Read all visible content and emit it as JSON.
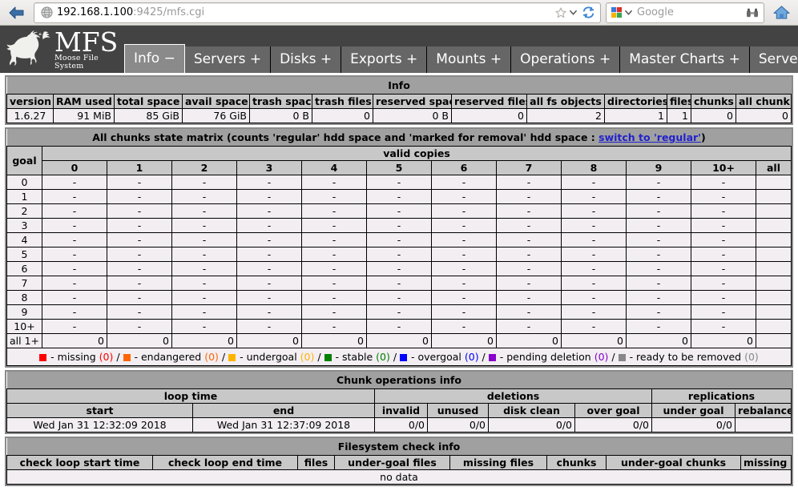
{
  "browser": {
    "back_icon": "back-arrow-icon",
    "favicon": "globe-icon",
    "url_host": "192.168.1.100",
    "url_rest": ":9425/mfs.cgi",
    "star_icon": "star-icon",
    "chevron_icon": "chevron-down-icon",
    "reload_icon": "reload-icon",
    "search_engine_icon": "google-icon",
    "search_placeholder": "Google",
    "search_value": "",
    "binoculars_icon": "binoculars-icon",
    "home_icon": "home-icon"
  },
  "header": {
    "logo_title": "MFS",
    "logo_subtitle": "Moose File System",
    "moose_icon": "moose-logo-icon",
    "tabs": [
      {
        "label": "Info −",
        "active": true
      },
      {
        "label": "Servers +",
        "active": false
      },
      {
        "label": "Disks +",
        "active": false
      },
      {
        "label": "Exports +",
        "active": false
      },
      {
        "label": "Mounts +",
        "active": false
      },
      {
        "label": "Operations +",
        "active": false
      },
      {
        "label": "Master Charts +",
        "active": false
      },
      {
        "label": "Server Charts +",
        "active": false
      }
    ]
  },
  "info": {
    "title": "Info",
    "columns": [
      "version",
      "RAM used",
      "total space",
      "avail space",
      "trash space",
      "trash files",
      "reserved space",
      "reserved files",
      "all fs objects",
      "directories",
      "files",
      "chunks",
      "all chunk copies"
    ],
    "row": [
      "1.6.27",
      "91 MiB",
      "85 GiB",
      "76 GiB",
      "0 B",
      "0",
      "0 B",
      "0",
      "2",
      "1",
      "1",
      "0",
      "0"
    ]
  },
  "matrix": {
    "title_pre": "All chunks state matrix (counts 'regular' hdd space and 'marked for removal' hdd space : ",
    "title_link": "switch to 'regular'",
    "title_post": ")",
    "goal_label": "goal",
    "valid_copies_label": "valid copies",
    "columns": [
      "0",
      "1",
      "2",
      "3",
      "4",
      "5",
      "6",
      "7",
      "8",
      "9",
      "10+",
      "all"
    ],
    "rows": [
      {
        "goal": "0",
        "values": [
          "-",
          "-",
          "-",
          "-",
          "-",
          "-",
          "-",
          "-",
          "-",
          "-",
          "-",
          ""
        ]
      },
      {
        "goal": "1",
        "values": [
          "-",
          "-",
          "-",
          "-",
          "-",
          "-",
          "-",
          "-",
          "-",
          "-",
          "-",
          ""
        ]
      },
      {
        "goal": "2",
        "values": [
          "-",
          "-",
          "-",
          "-",
          "-",
          "-",
          "-",
          "-",
          "-",
          "-",
          "-",
          ""
        ]
      },
      {
        "goal": "3",
        "values": [
          "-",
          "-",
          "-",
          "-",
          "-",
          "-",
          "-",
          "-",
          "-",
          "-",
          "-",
          ""
        ]
      },
      {
        "goal": "4",
        "values": [
          "-",
          "-",
          "-",
          "-",
          "-",
          "-",
          "-",
          "-",
          "-",
          "-",
          "-",
          ""
        ]
      },
      {
        "goal": "5",
        "values": [
          "-",
          "-",
          "-",
          "-",
          "-",
          "-",
          "-",
          "-",
          "-",
          "-",
          "-",
          ""
        ]
      },
      {
        "goal": "6",
        "values": [
          "-",
          "-",
          "-",
          "-",
          "-",
          "-",
          "-",
          "-",
          "-",
          "-",
          "-",
          ""
        ]
      },
      {
        "goal": "7",
        "values": [
          "-",
          "-",
          "-",
          "-",
          "-",
          "-",
          "-",
          "-",
          "-",
          "-",
          "-",
          ""
        ]
      },
      {
        "goal": "8",
        "values": [
          "-",
          "-",
          "-",
          "-",
          "-",
          "-",
          "-",
          "-",
          "-",
          "-",
          "-",
          ""
        ]
      },
      {
        "goal": "9",
        "values": [
          "-",
          "-",
          "-",
          "-",
          "-",
          "-",
          "-",
          "-",
          "-",
          "-",
          "-",
          ""
        ]
      },
      {
        "goal": "10+",
        "values": [
          "-",
          "-",
          "-",
          "-",
          "-",
          "-",
          "-",
          "-",
          "-",
          "-",
          "-",
          ""
        ]
      },
      {
        "goal": "all 1+",
        "values": [
          "0",
          "0",
          "0",
          "0",
          "0",
          "0",
          "0",
          "0",
          "0",
          "0",
          "0",
          ""
        ]
      }
    ],
    "legend": [
      {
        "color": "#ff0000",
        "label": "missing",
        "count": "(0)",
        "count_color": "#ff0000"
      },
      {
        "color": "#ff6600",
        "label": "endangered",
        "count": "(0)",
        "count_color": "#ff6600"
      },
      {
        "color": "#ffb300",
        "label": "undergoal",
        "count": "(0)",
        "count_color": "#ffb300"
      },
      {
        "color": "#008000",
        "label": "stable",
        "count": "(0)",
        "count_color": "#008000"
      },
      {
        "color": "#0000ff",
        "label": "overgoal",
        "count": "(0)",
        "count_color": "#0000ff"
      },
      {
        "color": "#8800cc",
        "label": "pending deletion",
        "count": "(0)",
        "count_color": "#8800cc"
      },
      {
        "color": "#888888",
        "label": "ready to be removed",
        "count": "(0)",
        "count_color": "#888888"
      }
    ],
    "legend_sep": " / "
  },
  "chunkops": {
    "title": "Chunk operations info",
    "group_loop_time": "loop time",
    "group_deletions": "deletions",
    "group_replications": "replications",
    "columns": [
      "start",
      "end",
      "invalid",
      "unused",
      "disk clean",
      "over goal",
      "under goal",
      "rebalance"
    ],
    "row": [
      "Wed Jan 31 12:32:09 2018",
      "Wed Jan 31 12:37:09 2018",
      "0/0",
      "0/0",
      "0/0",
      "0/0",
      "0/0",
      ""
    ]
  },
  "fscheck": {
    "title": "Filesystem check info",
    "columns": [
      "check loop start time",
      "check loop end time",
      "files",
      "under-goal files",
      "missing files",
      "chunks",
      "under-goal chunks",
      "missing chunks"
    ],
    "no_data": "no data"
  }
}
